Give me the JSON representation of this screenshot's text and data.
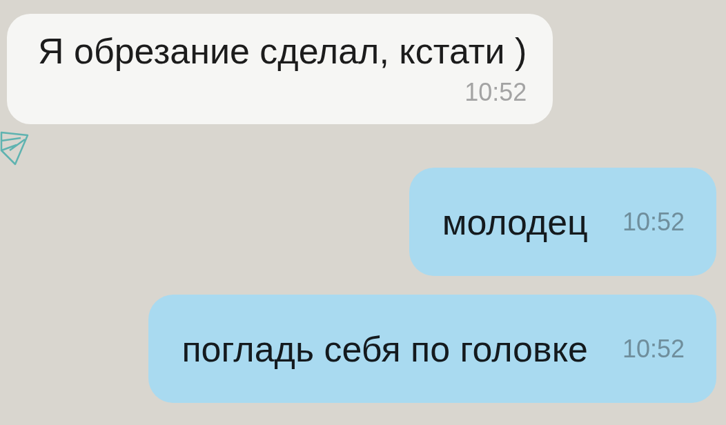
{
  "messages": [
    {
      "kind": "incoming",
      "text": "Я обрезание сделал, кстати )",
      "time": "10:52"
    },
    {
      "kind": "outgoing",
      "text": "молодец",
      "time": "10:52"
    },
    {
      "kind": "outgoing",
      "text": "погладь себя по головке",
      "time": "10:52"
    }
  ]
}
